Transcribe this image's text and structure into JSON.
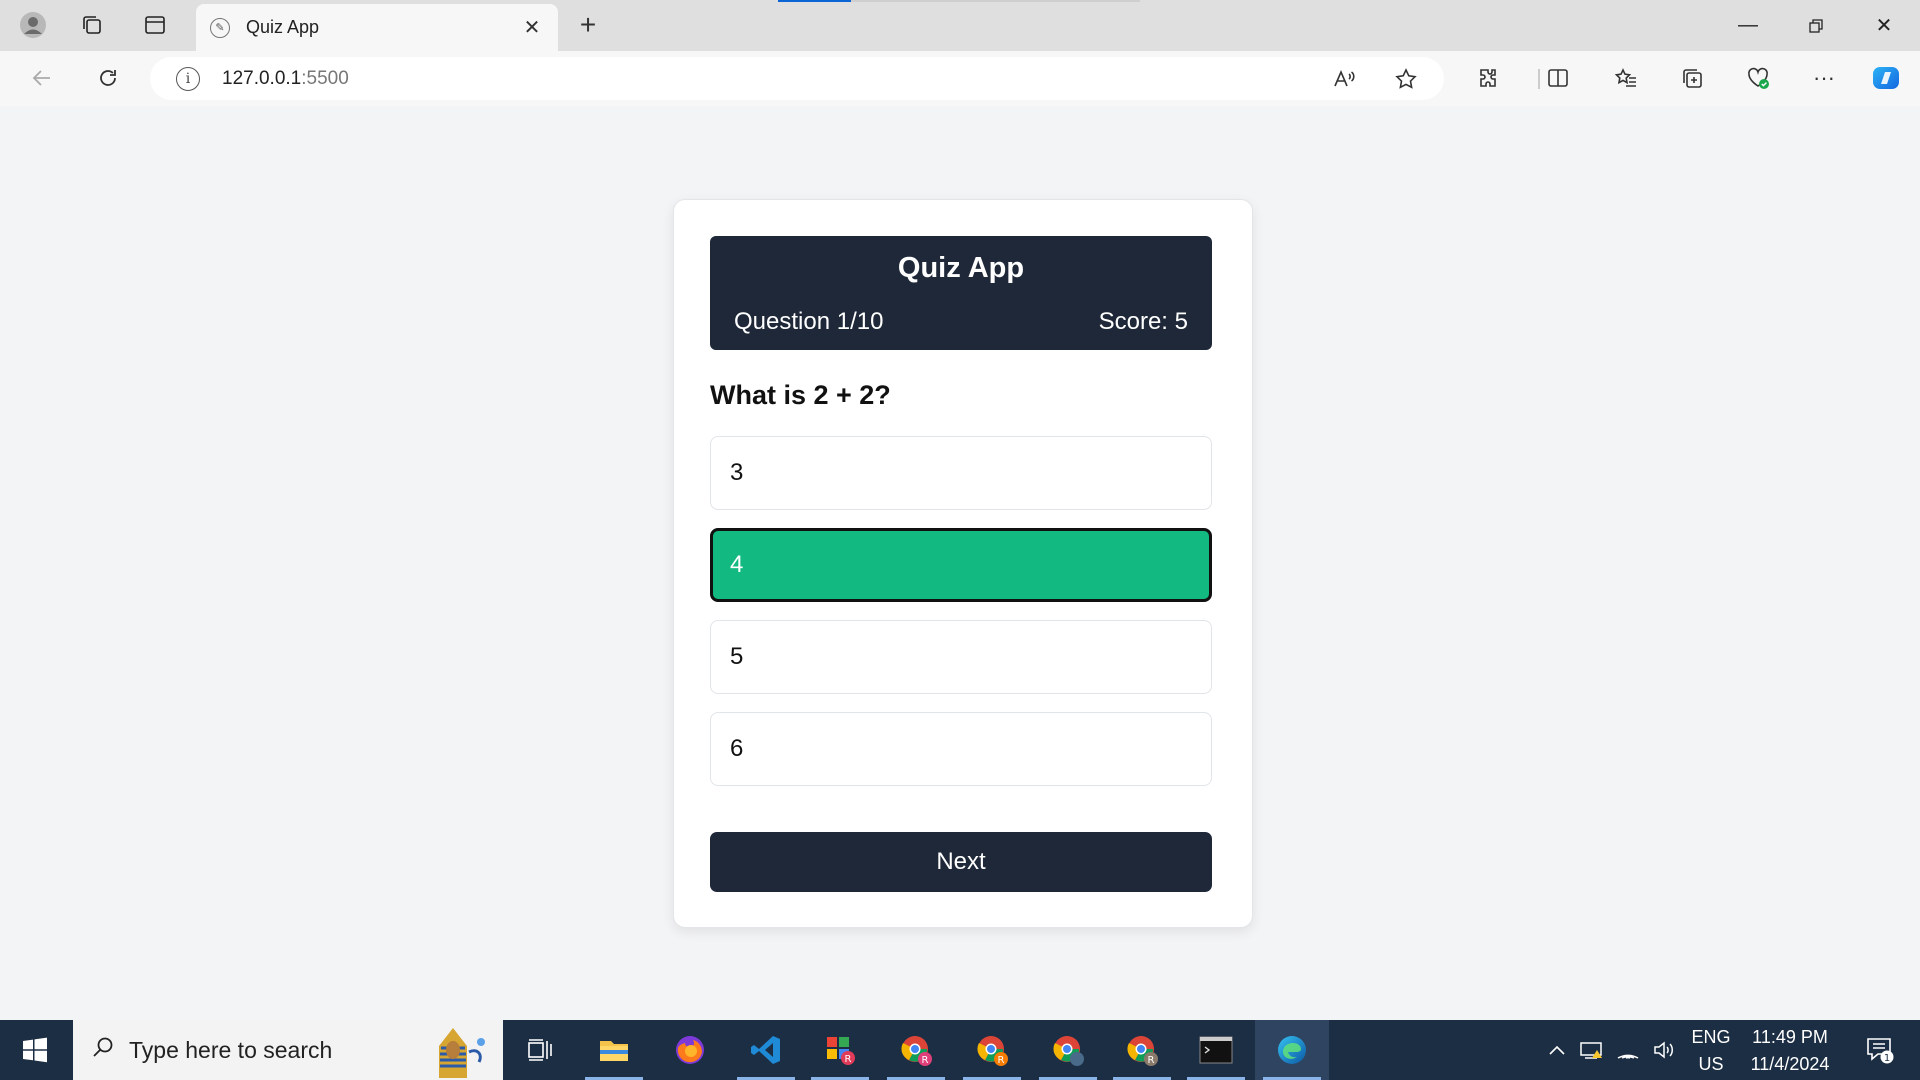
{
  "browser": {
    "tab_title": "Quiz App",
    "url_host": "127.0.0.1",
    "url_port": ":5500"
  },
  "quiz": {
    "app_title": "Quiz App",
    "question_counter": "Question 1/10",
    "score": "Score: 5",
    "question": "What is 2 + 2?",
    "options": [
      "3",
      "4",
      "5",
      "6"
    ],
    "selected_index": 1,
    "next_label": "Next",
    "colors": {
      "header": "#1e2838",
      "selected": "#12b981"
    }
  },
  "taskbar": {
    "search_placeholder": "Type here to search",
    "lang_primary": "ENG",
    "lang_secondary": "US",
    "time": "11:49 PM",
    "date": "11/4/2024",
    "notification_count": "1"
  }
}
